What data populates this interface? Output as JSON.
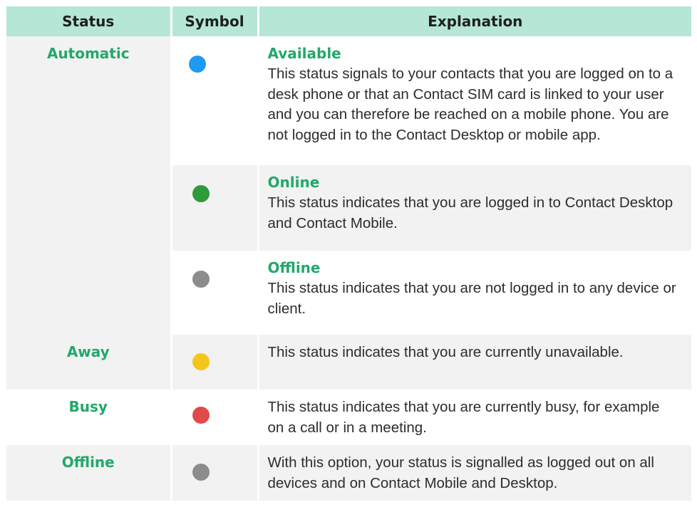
{
  "header": {
    "status": "Status",
    "symbol": "Symbol",
    "explanation": "Explanation"
  },
  "colors": {
    "header_bg": "#b5e6d6",
    "accent_green": "#22a86a",
    "shaded_row": "#f2f2f2"
  },
  "rows": [
    {
      "status": "Automatic",
      "symbol_color": "#1e9af5",
      "symbol_name": "blue-dot-icon",
      "title": "Available",
      "text": "This status signals to your contacts that you are logged on to a desk phone or that an Contact SIM card is linked to your user and you can therefore be reached on a mobile phone. You are not logged in to the Contact Desktop or mobile app."
    },
    {
      "status": "",
      "symbol_color": "#2e9a3a",
      "symbol_name": "green-dot-icon",
      "title": "Online",
      "text": "This status indicates that you are logged in to Contact Desktop and Contact Mobile."
    },
    {
      "status": "",
      "symbol_color": "#8c8c8c",
      "symbol_name": "grey-dot-icon",
      "title": "Offline",
      "text": "This status indicates that you are not logged in to any device or client."
    },
    {
      "status": "Away",
      "symbol_color": "#f5c51c",
      "symbol_name": "yellow-dot-icon",
      "title": "",
      "text": "This status indicates that you are currently unavailable."
    },
    {
      "status": "Busy",
      "symbol_color": "#e14a4a",
      "symbol_name": "red-dot-icon",
      "title": "",
      "text": "This status indicates that you are currently busy, for example on a call or in a meeting."
    },
    {
      "status": "Offline",
      "symbol_color": "#8c8c8c",
      "symbol_name": "grey-dot-icon",
      "title": "",
      "text": "With this option, your status is signalled as logged out on all devices and on Contact Mobile and Desktop."
    }
  ]
}
